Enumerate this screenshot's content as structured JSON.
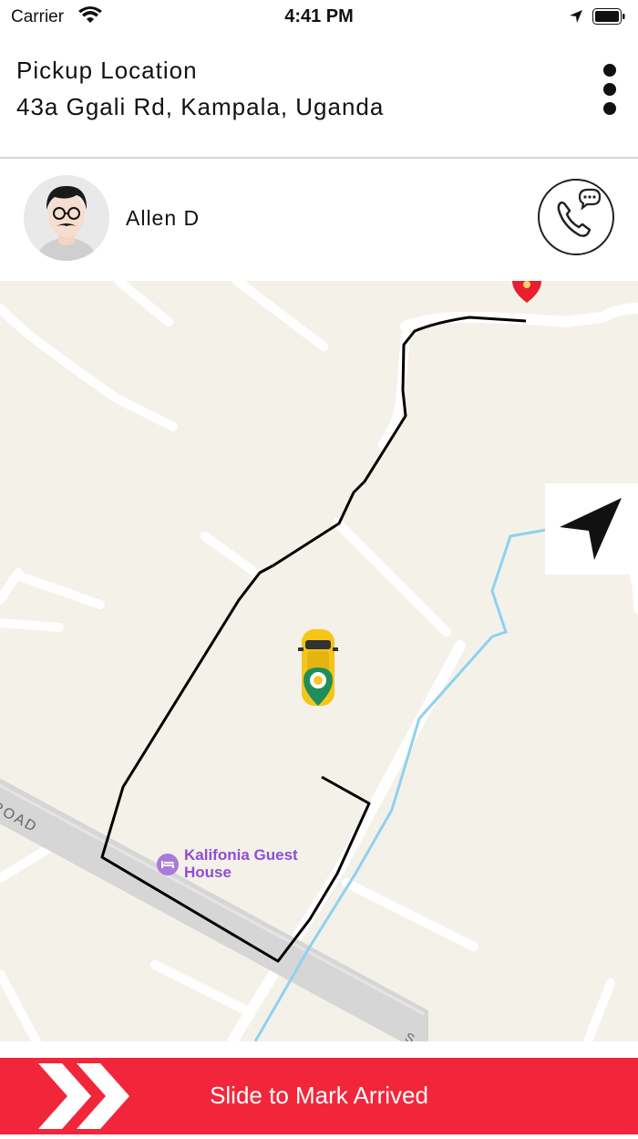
{
  "status_bar": {
    "carrier": "Carrier",
    "time": "4:41 PM"
  },
  "pickup": {
    "label": "Pickup Location",
    "address": "43a Ggali Rd, Kampala, Uganda"
  },
  "driver": {
    "name": "Allen D"
  },
  "map": {
    "poi_name": "Kalifonia Guest House",
    "road_label": "ROAD",
    "road_label_2": "S",
    "route_color": "#000000",
    "water_color": "#8fd1f0"
  },
  "slider": {
    "label": "Slide to Mark Arrived",
    "color": "#f2263a"
  },
  "icons": {
    "wifi": "wifi-icon",
    "location_arrow": "location-arrow-icon",
    "battery": "battery-icon",
    "menu": "more-vertical-icon",
    "call": "phone-chat-icon",
    "navigate": "navigation-arrow-icon",
    "car": "taxi-car-icon",
    "destination": "destination-pin-icon",
    "hotel": "hotel-icon",
    "chevrons": "double-chevron-right-icon"
  }
}
